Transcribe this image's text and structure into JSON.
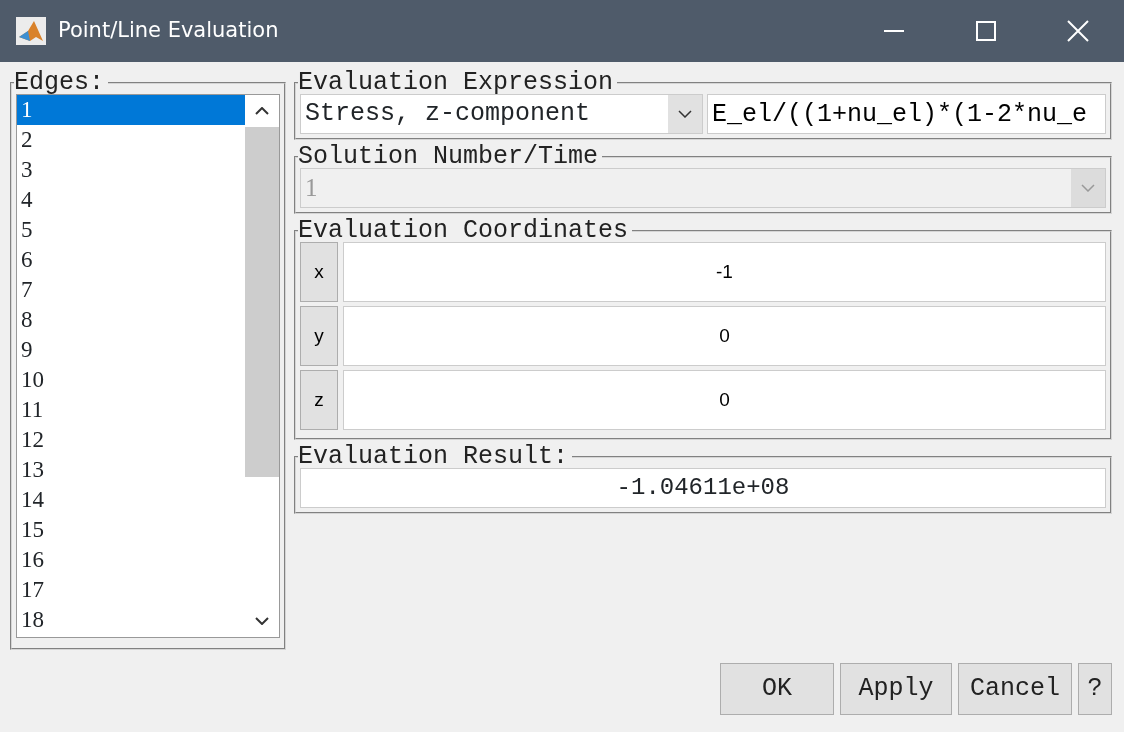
{
  "window": {
    "title": "Point/Line Evaluation"
  },
  "edges": {
    "label": "Edges:",
    "items": [
      {
        "label": "1",
        "selected": true
      },
      {
        "label": "2",
        "selected": false
      },
      {
        "label": "3",
        "selected": false
      },
      {
        "label": "4",
        "selected": false
      },
      {
        "label": "5",
        "selected": false
      },
      {
        "label": "6",
        "selected": false
      },
      {
        "label": "7",
        "selected": false
      },
      {
        "label": "8",
        "selected": false
      },
      {
        "label": "9",
        "selected": false
      },
      {
        "label": "10",
        "selected": false
      },
      {
        "label": "11",
        "selected": false
      },
      {
        "label": "12",
        "selected": false
      },
      {
        "label": "13",
        "selected": false
      },
      {
        "label": "14",
        "selected": false
      },
      {
        "label": "15",
        "selected": false
      },
      {
        "label": "16",
        "selected": false
      },
      {
        "label": "17",
        "selected": false
      },
      {
        "label": "18",
        "selected": false
      }
    ]
  },
  "expression": {
    "label": "Evaluation Expression",
    "preset": "Stress, z-component",
    "value": "E_el/((1+nu_el)*(1-2*nu_e"
  },
  "solution": {
    "label": "Solution Number/Time",
    "value": "1",
    "disabled": true
  },
  "coordinates": {
    "label": "Evaluation Coordinates",
    "rows": [
      {
        "axis": "x",
        "value": "-1"
      },
      {
        "axis": "y",
        "value": "0"
      },
      {
        "axis": "z",
        "value": "0"
      }
    ]
  },
  "result": {
    "label": "Evaluation Result:",
    "value": "-1.04611e+08"
  },
  "buttons": [
    "OK",
    "Apply",
    "Cancel",
    "?"
  ]
}
